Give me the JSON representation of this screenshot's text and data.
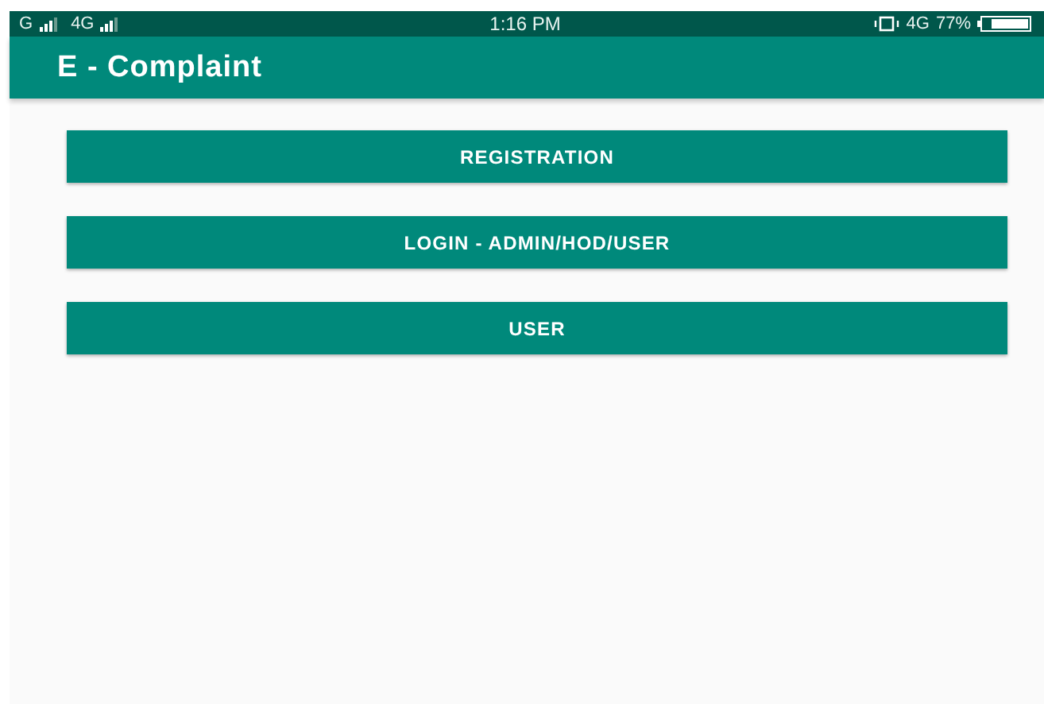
{
  "status_bar": {
    "carriers": [
      "G",
      "4G"
    ],
    "time": "1:16 PM",
    "network": "4G",
    "battery": "77%"
  },
  "app_bar": {
    "title": "E - Complaint"
  },
  "buttons": [
    "REGISTRATION",
    "LOGIN - ADMIN/HOD/USER",
    "USER"
  ]
}
